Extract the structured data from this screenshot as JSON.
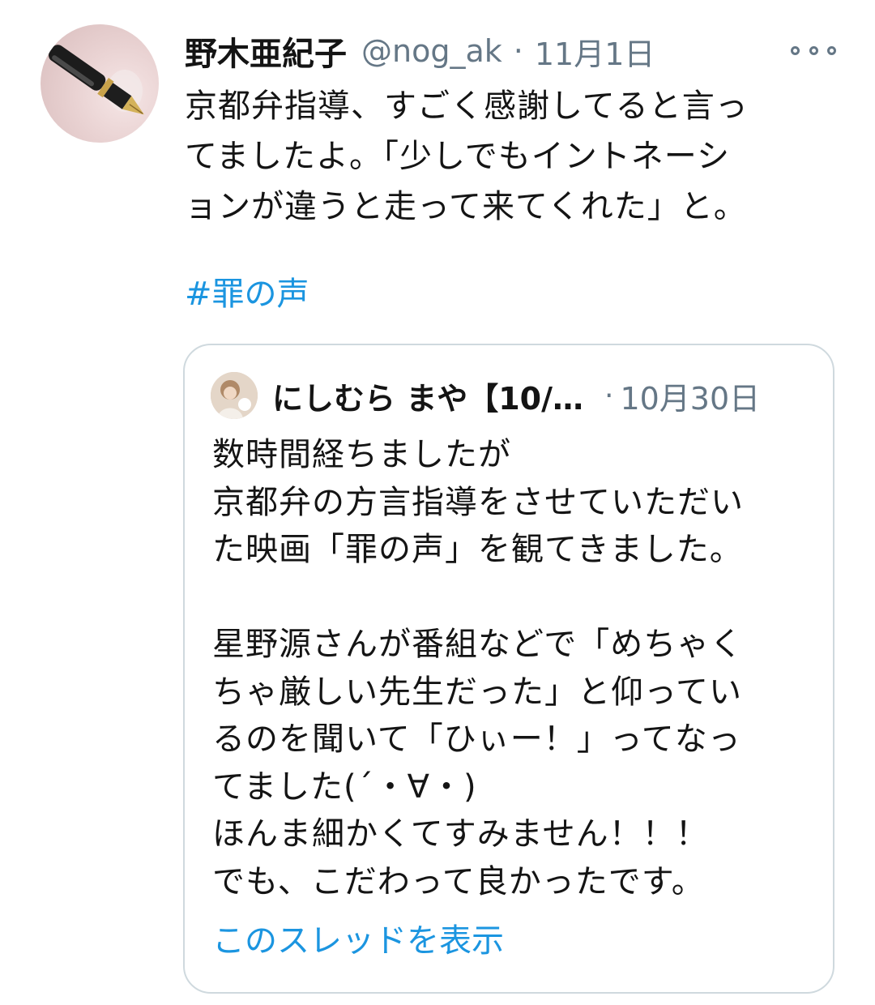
{
  "tweet": {
    "author_name": "野木亜紀子",
    "handle": "@nog_ak",
    "separator": "·",
    "date": "11月1日",
    "more_icon": "more-options-icon",
    "text_lines": [
      "京都弁指導、すごく感謝してると言っ",
      "てましたよ。「少しでもイントネーシ",
      "ョンが違うと走って来てくれた」と。"
    ],
    "hashtag": "#罪の声"
  },
  "quoted": {
    "author_name": "にしむら まや【10/…",
    "separator": "·",
    "date": "10月30日",
    "text_lines": [
      "数時間経ちましたが",
      "京都弁の方言指導をさせていただい",
      "た映画「罪の声」を観てきました。",
      "",
      "星野源さんが番組などで「めちゃく",
      "ちゃ厳しい先生だった」と仰ってい",
      "るのを聞いて「ひぃー！」ってなっ",
      "てました(´・∀・)",
      "ほんま細かくてすみません！！！",
      "でも、こだわって良かったです。"
    ],
    "thread_link": "このスレッドを表示"
  },
  "colors": {
    "text": "#141414",
    "secondary": "#657786",
    "link": "#1b95e0",
    "border": "#cfd9de"
  }
}
